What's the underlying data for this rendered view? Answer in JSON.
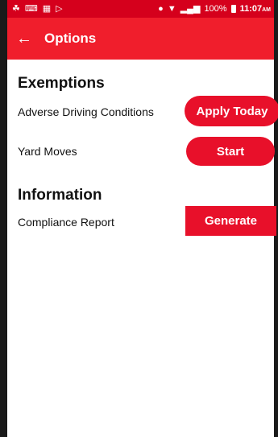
{
  "status_bar": {
    "battery": "100%",
    "time": "11:07",
    "time_suffix": "AM"
  },
  "header": {
    "back_glyph": "←",
    "title": "Options"
  },
  "exemptions": {
    "heading": "Exemptions",
    "items": [
      {
        "label": "Adverse Driving Conditions",
        "button": "Apply Today"
      },
      {
        "label": "Yard Moves",
        "button": "Start"
      }
    ]
  },
  "information": {
    "heading": "Information",
    "items": [
      {
        "label": "Compliance Report",
        "button": "Generate"
      }
    ]
  },
  "colors": {
    "accent": "#f01e2c",
    "status_bar": "#d5001c",
    "button": "#e8102a"
  }
}
